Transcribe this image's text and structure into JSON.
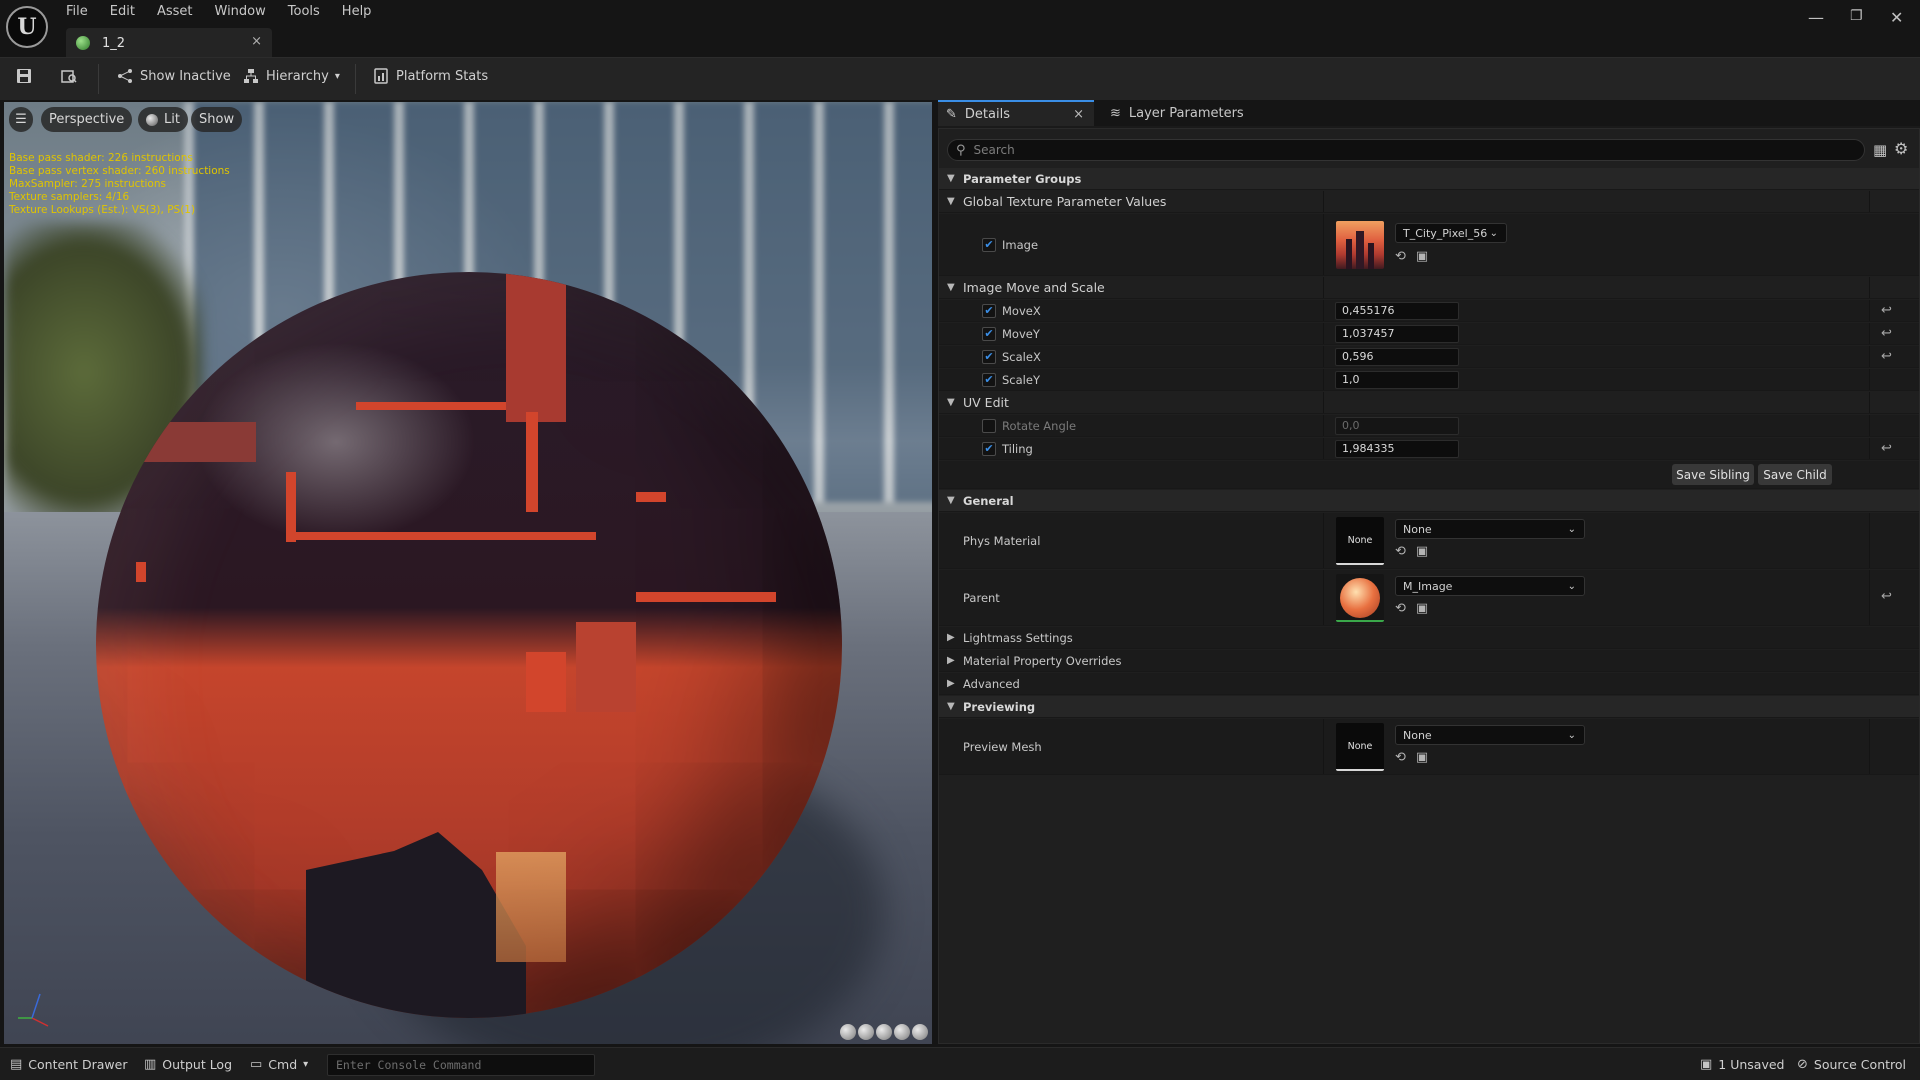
{
  "menu": [
    "File",
    "Edit",
    "Asset",
    "Window",
    "Tools",
    "Help"
  ],
  "document_tab": {
    "title": "1_2",
    "close": "×"
  },
  "window_controls": {
    "minimize": "—",
    "restore": "❐",
    "close": "✕"
  },
  "toolbar": {
    "show_inactive": "Show Inactive",
    "hierarchy": "Hierarchy",
    "platform_stats": "Platform Stats"
  },
  "viewport": {
    "perspective": "Perspective",
    "lit": "Lit",
    "show": "Show",
    "stats": [
      "Base pass shader: 226 instructions",
      "Base pass vertex shader: 260 instructions",
      "MaxSampler: 275 instructions",
      "Texture samplers: 4/16",
      "Texture Lookups (Est.): VS(3), PS(1)"
    ]
  },
  "details": {
    "tab_details": "Details",
    "tab_layer_parameters": "Layer Parameters",
    "search_placeholder": "Search",
    "parameter_groups": "Parameter Groups",
    "global_texture": {
      "title": "Global Texture Parameter Values",
      "image_label": "Image",
      "image_value": "T_City_Pixel_56"
    },
    "move_scale": {
      "title": "Image Move and Scale",
      "params": [
        {
          "label": "MoveX",
          "value": "0,455176",
          "checked": true,
          "reset": true
        },
        {
          "label": "MoveY",
          "value": "1,037457",
          "checked": true,
          "reset": true
        },
        {
          "label": "ScaleX",
          "value": "0,596",
          "checked": true,
          "reset": true
        },
        {
          "label": "ScaleY",
          "value": "1,0",
          "checked": true,
          "reset": false
        }
      ]
    },
    "uv_edit": {
      "title": "UV Edit",
      "params": [
        {
          "label": "Rotate Angle",
          "value": "0,0",
          "checked": false,
          "reset": false
        },
        {
          "label": "Tiling",
          "value": "1,984335",
          "checked": true,
          "reset": true
        }
      ]
    },
    "save_sibling": "Save Sibling",
    "save_child": "Save Child",
    "general": {
      "title": "General",
      "phys_material_label": "Phys Material",
      "phys_material_thumb": "None",
      "phys_material_value": "None",
      "parent_label": "Parent",
      "parent_value": "M_Image"
    },
    "collapsed": [
      "Lightmass Settings",
      "Material Property Overrides",
      "Advanced"
    ],
    "previewing": {
      "title": "Previewing",
      "preview_mesh_label": "Preview Mesh",
      "preview_mesh_thumb": "None",
      "preview_mesh_value": "None"
    }
  },
  "statusbar": {
    "content_drawer": "Content Drawer",
    "output_log": "Output Log",
    "cmd": "Cmd",
    "console_placeholder": "Enter Console Command",
    "unsaved": "1 Unsaved",
    "source_control": "Source Control"
  }
}
